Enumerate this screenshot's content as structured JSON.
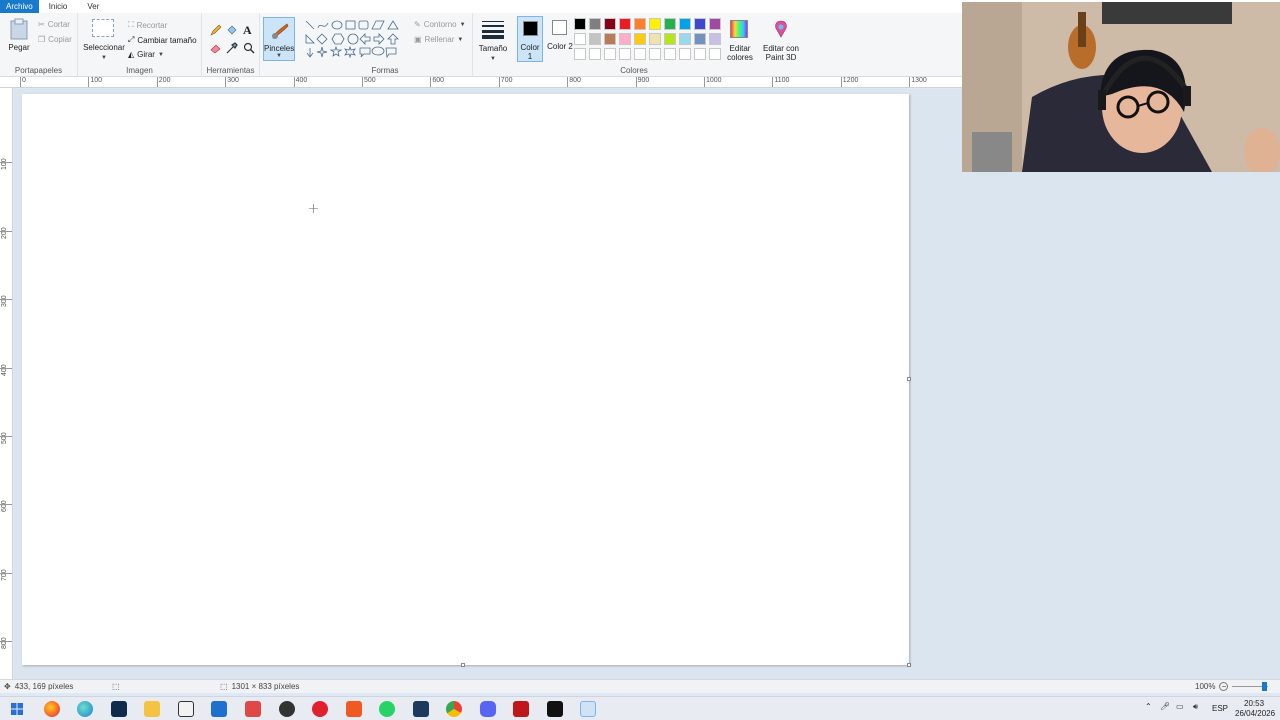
{
  "menu": {
    "file": "Archivo",
    "home": "Inicio",
    "view": "Ver"
  },
  "clipboard": {
    "paste": "Pegar",
    "cut": "Cortar",
    "copy": "Copiar",
    "label": "Portapapeles"
  },
  "image": {
    "select": "Seleccionar",
    "crop": "Recortar",
    "resize": "Cambiar tamaño",
    "rotate": "Girar",
    "label": "Imagen"
  },
  "tools": {
    "label": "Herramientas",
    "text_glyph": "A"
  },
  "brushes": {
    "label": "Pinceles"
  },
  "shapes": {
    "outline": "Contorno",
    "fill": "Rellenar",
    "label": "Formas"
  },
  "size": {
    "label": "Tamaño"
  },
  "colors": {
    "color1": "Color 1",
    "color2": "Color 2",
    "edit_colors": "Editar colores",
    "paint3d": "Editar con Paint 3D",
    "label": "Colores",
    "color1_value": "#000000",
    "color2_value": "#ffffff",
    "palette_row1": [
      "#000000",
      "#7f7f7f",
      "#880015",
      "#ed1c24",
      "#ff7f27",
      "#fff200",
      "#22b14c",
      "#00a2e8",
      "#3f48cc",
      "#a349a4"
    ],
    "palette_row2": [
      "#ffffff",
      "#c3c3c3",
      "#b97a57",
      "#ffaec9",
      "#ffc90e",
      "#efe4b0",
      "#b5e61d",
      "#99d9ea",
      "#7092be",
      "#c8bfe7"
    ]
  },
  "ruler": {
    "h_ticks": [
      "0",
      "100",
      "200",
      "300",
      "400",
      "500",
      "600",
      "700",
      "800",
      "900",
      "1000",
      "1100",
      "1200",
      "1300"
    ],
    "v_ticks": [
      "100",
      "200",
      "300",
      "400",
      "500",
      "600",
      "700",
      "800"
    ]
  },
  "status": {
    "cursor": "433, 169 píxeles",
    "size": "1301 × 833 píxeles",
    "zoom": "100%"
  },
  "tray": {
    "lang": "ESP",
    "time": "20:53",
    "date": "26/04/2026"
  }
}
